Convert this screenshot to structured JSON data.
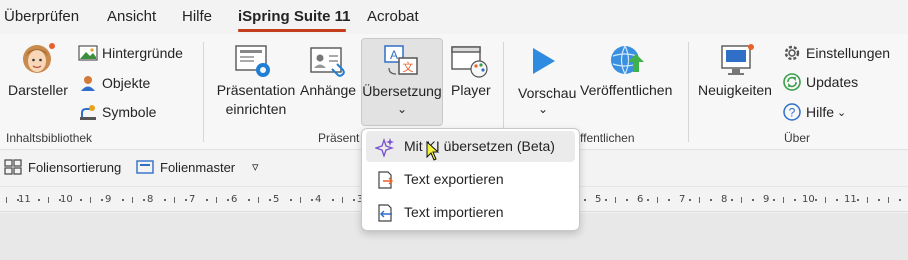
{
  "tabs": [
    {
      "label": "Überprüfen",
      "active": false
    },
    {
      "label": "Ansicht",
      "active": false
    },
    {
      "label": "Hilfe",
      "active": false
    },
    {
      "label": "iSpring Suite 11",
      "active": true
    },
    {
      "label": "Acrobat",
      "active": false
    }
  ],
  "ribbon": {
    "inhaltsbibliothek": {
      "group_label": "Inhaltsbibliothek",
      "darsteller": "Darsteller",
      "hintergruende": "Hintergründe",
      "objekte": "Objekte",
      "symbole": "Symbole"
    },
    "praesentation": {
      "group_label": "Präsent",
      "praesentation_einrichten_line1": "Präsentation",
      "praesentation_einrichten_line2": "einrichten",
      "anhaenge": "Anhänge",
      "uebersetzung": "Übersetzung",
      "uebersetzung_chevron": "⌄",
      "player": "Player"
    },
    "veroeffentlichen": {
      "group_label": "ffentlichen",
      "vorschau": "Vorschau",
      "vorschau_chevron": "⌄",
      "veroeffentlichen": "Veröffentlichen"
    },
    "ueber": {
      "group_label": "Über",
      "neuigkeiten": "Neuigkeiten",
      "einstellungen": "Einstellungen",
      "updates": "Updates",
      "hilfe": "Hilfe",
      "hilfe_chevron": "⌄"
    }
  },
  "toolbar": {
    "foliensortierung": "Foliensortierung",
    "folienmaster": "Folienmaster",
    "more": "▿"
  },
  "ruler": {
    "left_numbers": [
      "11",
      "10",
      "9",
      "8",
      "7",
      "6",
      "5",
      "4",
      "3"
    ],
    "right_numbers": [
      "5",
      "6",
      "7",
      "8",
      "9",
      "10",
      "11"
    ]
  },
  "dropdown": {
    "items": [
      {
        "label": "Mit KI übersetzen (Beta)",
        "icon": "sparkle-icon",
        "hover": true
      },
      {
        "label": "Text exportieren",
        "icon": "export-document-icon",
        "hover": false
      },
      {
        "label": "Text importieren",
        "icon": "import-document-icon",
        "hover": false
      }
    ]
  },
  "colors": {
    "accent": "#c43e1c",
    "icon_blue": "#2f6fc8",
    "icon_gear": "#1f7fd6"
  }
}
